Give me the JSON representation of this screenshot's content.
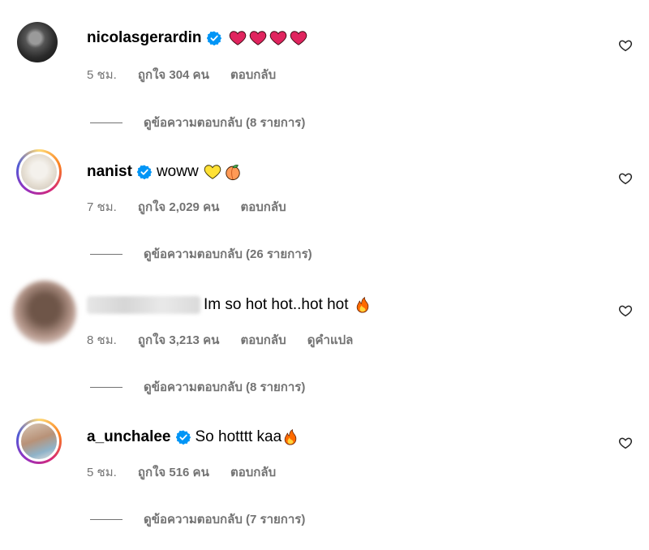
{
  "comments": [
    {
      "username": "nicolasgerardin",
      "verified": true,
      "text": "",
      "emojis": [
        "red-heart",
        "red-heart",
        "red-heart",
        "red-heart"
      ],
      "time": "5 ชม.",
      "likes": "ถูกใจ 304 คน",
      "reply": "ตอบกลับ",
      "view_replies": "ดูข้อความตอบกลับ (8 รายการ)"
    },
    {
      "username": "nanist",
      "verified": true,
      "text": "woww",
      "emojis": [
        "yellow-heart",
        "peach"
      ],
      "time": "7 ชม.",
      "likes": "ถูกใจ 2,029 คน",
      "reply": "ตอบกลับ",
      "view_replies": "ดูข้อความตอบกลับ (26 รายการ)"
    },
    {
      "username": "",
      "verified": false,
      "text": "Im so hot hot..hot hot",
      "emojis": [
        "fire"
      ],
      "time": "8 ชม.",
      "likes": "ถูกใจ 3,213 คน",
      "reply": "ตอบกลับ",
      "translate": "ดูคำแปล",
      "view_replies": "ดูข้อความตอบกลับ (8 รายการ)"
    },
    {
      "username": "a_unchalee",
      "verified": true,
      "text": "So hotttt kaa",
      "emojis": [
        "fire"
      ],
      "time": "5 ชม.",
      "likes": "ถูกใจ 516 คน",
      "reply": "ตอบกลับ",
      "view_replies": "ดูข้อความตอบกลับ (7 รายการ)"
    }
  ],
  "colors": {
    "verified": "#0095f6",
    "meta": "#737373",
    "red_heart": "#e0245e"
  }
}
